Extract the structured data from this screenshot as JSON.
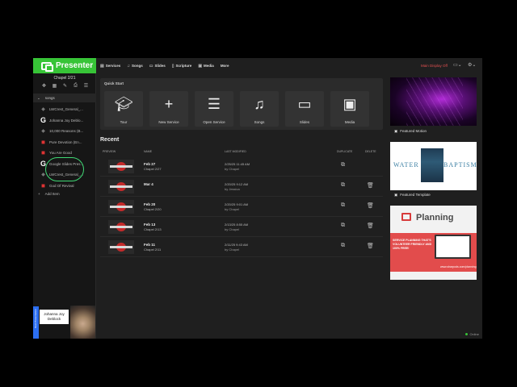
{
  "brand": {
    "title": "Presenter"
  },
  "sidebar": {
    "doc_title": "Chapel 2/21",
    "section_label": "songs",
    "add_item": "Add Item",
    "items": [
      {
        "label": "LWCrest_General_...",
        "icon": "logo-icon"
      },
      {
        "label": "Johanna Joy Deblo...",
        "icon": "google-icon"
      },
      {
        "label": "10,000 Reasons (B...",
        "icon": "logo-icon"
      },
      {
        "label": "Pure Devotion (En...",
        "icon": "song-icon"
      },
      {
        "label": "You Are Good",
        "icon": "song-icon"
      },
      {
        "label": "Google Slides Pres...",
        "icon": "google-icon"
      },
      {
        "label": "LWCrest_General_...",
        "icon": "logo-icon"
      },
      {
        "label": "God Of Revival",
        "icon": "song-icon"
      }
    ]
  },
  "nav": {
    "items": [
      "Services",
      "Songs",
      "Slides",
      "Scripture",
      "Media",
      "More"
    ],
    "main_display": "Main Display Off"
  },
  "quick_start": {
    "title": "Quick Start",
    "tiles": [
      {
        "label": "Tour",
        "icon": "graduation-cap-icon"
      },
      {
        "label": "New Service",
        "icon": "plus-icon"
      },
      {
        "label": "Open Service",
        "icon": "list-icon"
      },
      {
        "label": "Songs",
        "icon": "music-notes-icon"
      },
      {
        "label": "Slides",
        "icon": "monitor-icon"
      },
      {
        "label": "Media",
        "icon": "image-icon"
      }
    ]
  },
  "recent": {
    "title": "Recent",
    "headers": {
      "preview": "PREVIEW",
      "name": "NAME",
      "modified": "LAST MODIFIED",
      "duplicate": "DUPLICATE",
      "delete": "DELETE"
    },
    "rows": [
      {
        "title": "Feb 27",
        "sub": "Chapel 2/27",
        "modified": "2/25/25 11:45 AM",
        "by": "by Chapel",
        "deletable": false
      },
      {
        "title": "Mar 4",
        "sub": "",
        "modified": "2/20/25 9:12 AM",
        "by": "by Jessica",
        "deletable": true
      },
      {
        "title": "Feb 20",
        "sub": "Chapel 2/20",
        "modified": "2/20/25 9:01 AM",
        "by": "by Chapel",
        "deletable": true
      },
      {
        "title": "Feb 13",
        "sub": "Chapel 2/13",
        "modified": "2/13/25 8:55 AM",
        "by": "by Chapel",
        "deletable": true
      },
      {
        "title": "Feb 11",
        "sub": "Chapel 2/11",
        "modified": "2/11/25 9:43 AM",
        "by": "by Chapel",
        "deletable": true
      }
    ]
  },
  "featured": {
    "motion_label": "Featured Motion",
    "template_label": "Featured Template",
    "template_left": "WATER",
    "template_right": "BAPTISM"
  },
  "ad": {
    "title": "Planning",
    "text": "SERVICE PLANNING THAT'S VOLUNTEER FRIENDLY AND 100% FREE!",
    "url": "www.sharpods.com/planning"
  },
  "status": {
    "online": "Online"
  },
  "overlay": {
    "side_tab": "Next Presentation",
    "name_line1": "Johanna Joy",
    "name_line2": "Deblock"
  }
}
